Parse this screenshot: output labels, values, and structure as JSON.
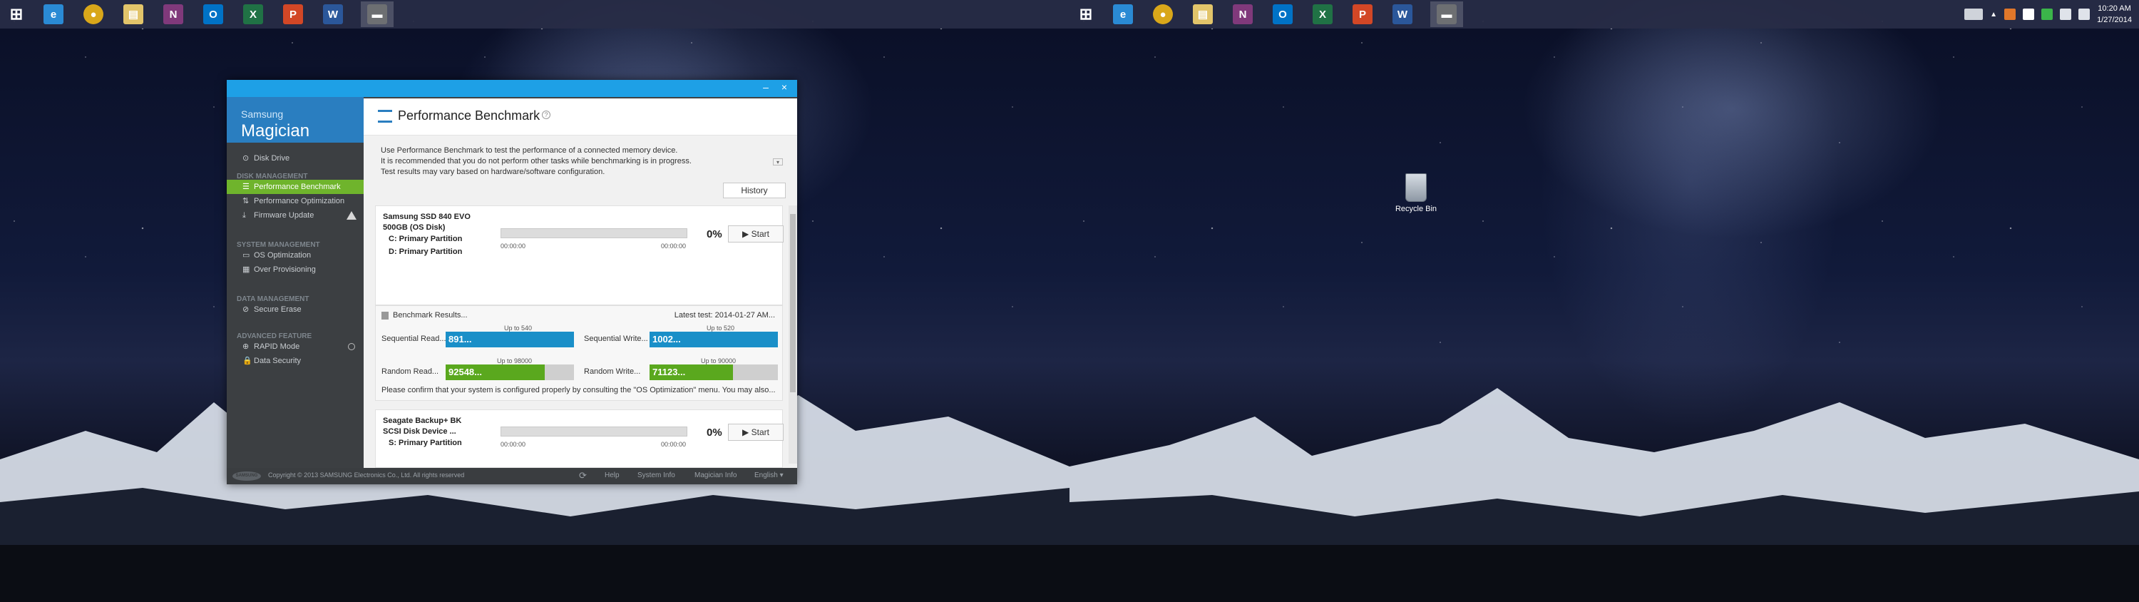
{
  "desktop": {
    "recycle_bin_label": "Recycle Bin",
    "clock_time": "10:20 AM",
    "clock_date": "1/27/2014"
  },
  "taskbar": {
    "apps": [
      {
        "name": "start",
        "glyph": "⊞",
        "color": "#2b2f4a"
      },
      {
        "name": "internet-explorer",
        "glyph": "e",
        "color": "#2a8ad4"
      },
      {
        "name": "chrome",
        "glyph": "●",
        "color": "#d9a71a"
      },
      {
        "name": "file-explorer",
        "glyph": "▤",
        "color": "#e2c46a"
      },
      {
        "name": "onenote",
        "glyph": "N",
        "color": "#80397b"
      },
      {
        "name": "outlook",
        "glyph": "O",
        "color": "#0072c6"
      },
      {
        "name": "excel",
        "glyph": "X",
        "color": "#207245"
      },
      {
        "name": "powerpoint",
        "glyph": "P",
        "color": "#d24726"
      },
      {
        "name": "word",
        "glyph": "W",
        "color": "#2b579a"
      },
      {
        "name": "samsung-magician",
        "glyph": "▬",
        "color": "#6d6f72"
      }
    ]
  },
  "app": {
    "brand_top": "Samsung",
    "brand_bottom": "Magician",
    "sidebar": {
      "disk_drive": "Disk Drive",
      "sections": {
        "disk_management": "DISK MANAGEMENT",
        "system_management": "SYSTEM MANAGEMENT",
        "data_management": "DATA MANAGEMENT",
        "advanced_feature": "ADVANCED FEATURE"
      },
      "items": {
        "performance_benchmark": "Performance Benchmark",
        "performance_optimization": "Performance Optimization",
        "firmware_update": "Firmware Update",
        "os_optimization": "OS Optimization",
        "over_provisioning": "Over Provisioning",
        "secure_erase": "Secure Erase",
        "rapid_mode": "RAPID Mode",
        "data_security": "Data Security"
      }
    },
    "main": {
      "title": "Performance Benchmark",
      "desc_line1": "Use Performance Benchmark to test the performance of a connected memory device.",
      "desc_line2": "It is recommended that you do not perform other tasks while benchmarking is in progress.",
      "desc_line3": "Test results may vary based on hardware/software configuration.",
      "history_button": "History",
      "disk1": {
        "name_line1": "Samsung SSD 840 EVO",
        "name_line2": "500GB  (OS Disk)",
        "part_c": "C: Primary Partition",
        "part_d": "D: Primary Partition",
        "time_start": "00:00:00",
        "time_end": "00:00:00",
        "progress": "0%",
        "start_label": "▶  Start"
      },
      "results": {
        "title": "Benchmark Results...",
        "latest": "Latest test: 2014-01-27 AM...",
        "seq_read_label": "Sequential Read...",
        "seq_read_value": "891...",
        "seq_read_upto": "Up to 540",
        "seq_write_label": "Sequential Write...",
        "seq_write_value": "1002...",
        "seq_write_upto": "Up to 520",
        "rand_read_label": "Random Read...",
        "rand_read_value": "92548...",
        "rand_read_upto": "Up to 98000",
        "rand_write_label": "Random Write...",
        "rand_write_value": "71123...",
        "rand_write_upto": "Up to 90000",
        "confirm_text": "Please confirm that your system is configured properly by consulting the \"OS Optimization\" menu. You may also..."
      },
      "disk2": {
        "name_line1": "Seagate Backup+  BK",
        "name_line2": "SCSI Disk Device   ...",
        "part_s": "S: Primary Partition",
        "time_start": "00:00:00",
        "time_end": "00:00:00",
        "progress": "0%",
        "start_label": "▶  Start"
      }
    },
    "footer": {
      "logo": "SAMSUNG",
      "copyright": "Copyright © 2013 SAMSUNG Electronics Co., Ltd. All rights reserved",
      "help": "Help",
      "system_info": "System Info",
      "magician_info": "Magician Info",
      "language": "English  ▾"
    }
  },
  "colors": {
    "accent_blue": "#1ea0e6",
    "green": "#6fb42c",
    "bar_blue": "#1a8fc8",
    "bar_green": "#5aa81e"
  }
}
